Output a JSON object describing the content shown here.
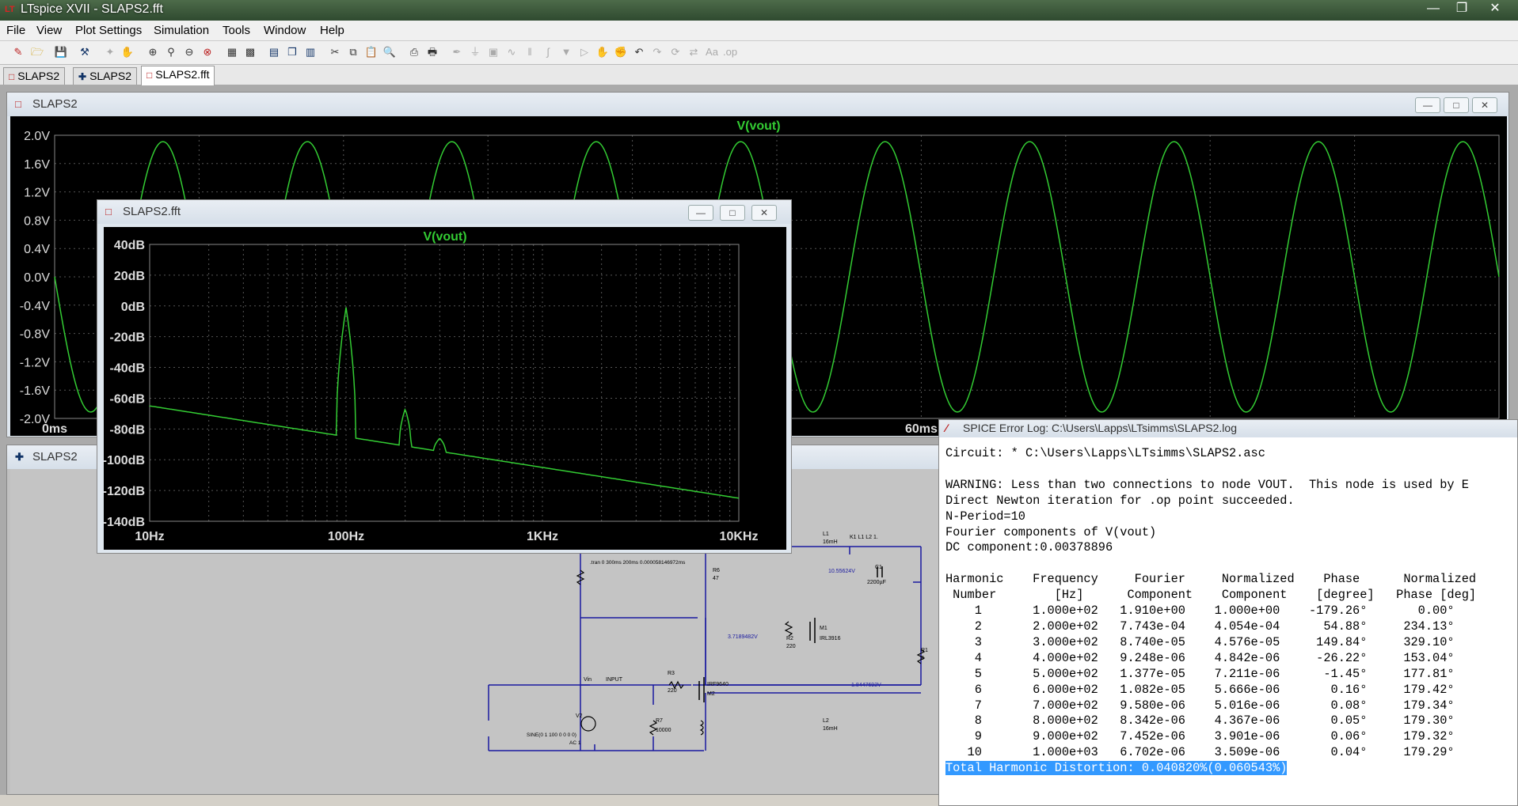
{
  "app": {
    "title": "LTspice XVII - SLAPS2.fft",
    "logo_glyph": "LT"
  },
  "menu": [
    "File",
    "View",
    "Plot Settings",
    "Simulation",
    "Tools",
    "Window",
    "Help"
  ],
  "tabs": [
    {
      "label": "SLAPS2",
      "icon": "waveform-icon"
    },
    {
      "label": "SLAPS2",
      "icon": "schematic-icon"
    },
    {
      "label": "SLAPS2.fft",
      "icon": "waveform-icon"
    }
  ],
  "colors": {
    "trace": "#33cc33",
    "plot_bg": "#000000",
    "grid": "#555555",
    "wire": "#1a1aa0",
    "highlight": "#3399ff"
  },
  "wave_window": {
    "title": "SLAPS2",
    "trace_label": "V(vout)",
    "y_ticks": [
      "2.0V",
      "1.6V",
      "1.2V",
      "0.8V",
      "0.4V",
      "0.0V",
      "-0.4V",
      "-0.8V",
      "-1.2V",
      "-1.6V",
      "-2.0V"
    ],
    "x_ticks": [
      "0ms",
      "60ms"
    ]
  },
  "fft_window": {
    "title": "SLAPS2.fft",
    "trace_label": "V(vout)",
    "y_ticks": [
      "40dB",
      "20dB",
      "0dB",
      "-20dB",
      "-40dB",
      "-60dB",
      "-80dB",
      "-100dB",
      "-120dB",
      "-140dB"
    ],
    "x_ticks": [
      "10Hz",
      "100Hz",
      "1KHz",
      "10KHz"
    ]
  },
  "schematic_window": {
    "title": "SLAPS2",
    "labels": {
      "tran": ".tran 0 300ms 200ms 0.000058146972ms",
      "r6": "R6",
      "r6v": "47",
      "l1": "L1",
      "l1v": "16mH",
      "k1": "K1 L1 L2 1.",
      "node1": "10.55624V",
      "c1": "C1",
      "c1v": "2200µF",
      "node2": "3.7189482V",
      "r2": "R2",
      "r2v": "220",
      "m1": "M1",
      "m1v": "IRL3916",
      "r1": "R1",
      "r1v": "8",
      "node3": "1.8447692V",
      "vin": "Vin",
      "input": "INPUT",
      "r3": "R3",
      "r3v": "220",
      "m2v": "IRF9640",
      "m2": "M2",
      "v2": "V2",
      "sine": "SINE(0 1 100 0 0 0 0)",
      "ac": "AC 1",
      "r7": "R7",
      "r7v": "10000",
      "l2": "L2",
      "l2v": "16mH"
    }
  },
  "error_log": {
    "title": "SPICE Error Log: C:\\Users\\Lapps\\LTsimms\\SLAPS2.log",
    "lines": [
      "Circuit: * C:\\Users\\Lapps\\LTsimms\\SLAPS2.asc",
      "",
      "WARNING: Less than two connections to node VOUT.  This node is used by E",
      "Direct Newton iteration for .op point succeeded.",
      "N-Period=10",
      "Fourier components of V(vout)",
      "DC component:0.00378896",
      "",
      "Harmonic    Frequency     Fourier     Normalized    Phase      Normalized",
      " Number        [Hz]      Component    Component    [degree]   Phase [deg]",
      "    1       1.000e+02   1.910e+00    1.000e+00    -179.26°       0.00°",
      "    2       2.000e+02   7.743e-04    4.054e-04      54.88°     234.13°",
      "    3       3.000e+02   8.740e-05    4.576e-05     149.84°     329.10°",
      "    4       4.000e+02   9.248e-06    4.842e-06     -26.22°     153.04°",
      "    5       5.000e+02   1.377e-05    7.211e-06      -1.45°     177.81°",
      "    6       6.000e+02   1.082e-05    5.666e-06       0.16°     179.42°",
      "    7       7.000e+02   9.580e-06    5.016e-06       0.08°     179.34°",
      "    8       8.000e+02   8.342e-06    4.367e-06       0.05°     179.30°",
      "    9       9.000e+02   7.452e-06    3.901e-06       0.06°     179.32°",
      "   10       1.000e+03   6.702e-06    3.509e-06       0.04°     179.29°"
    ],
    "thd": "Total Harmonic Distortion: 0.040820%(0.060543%)"
  }
}
